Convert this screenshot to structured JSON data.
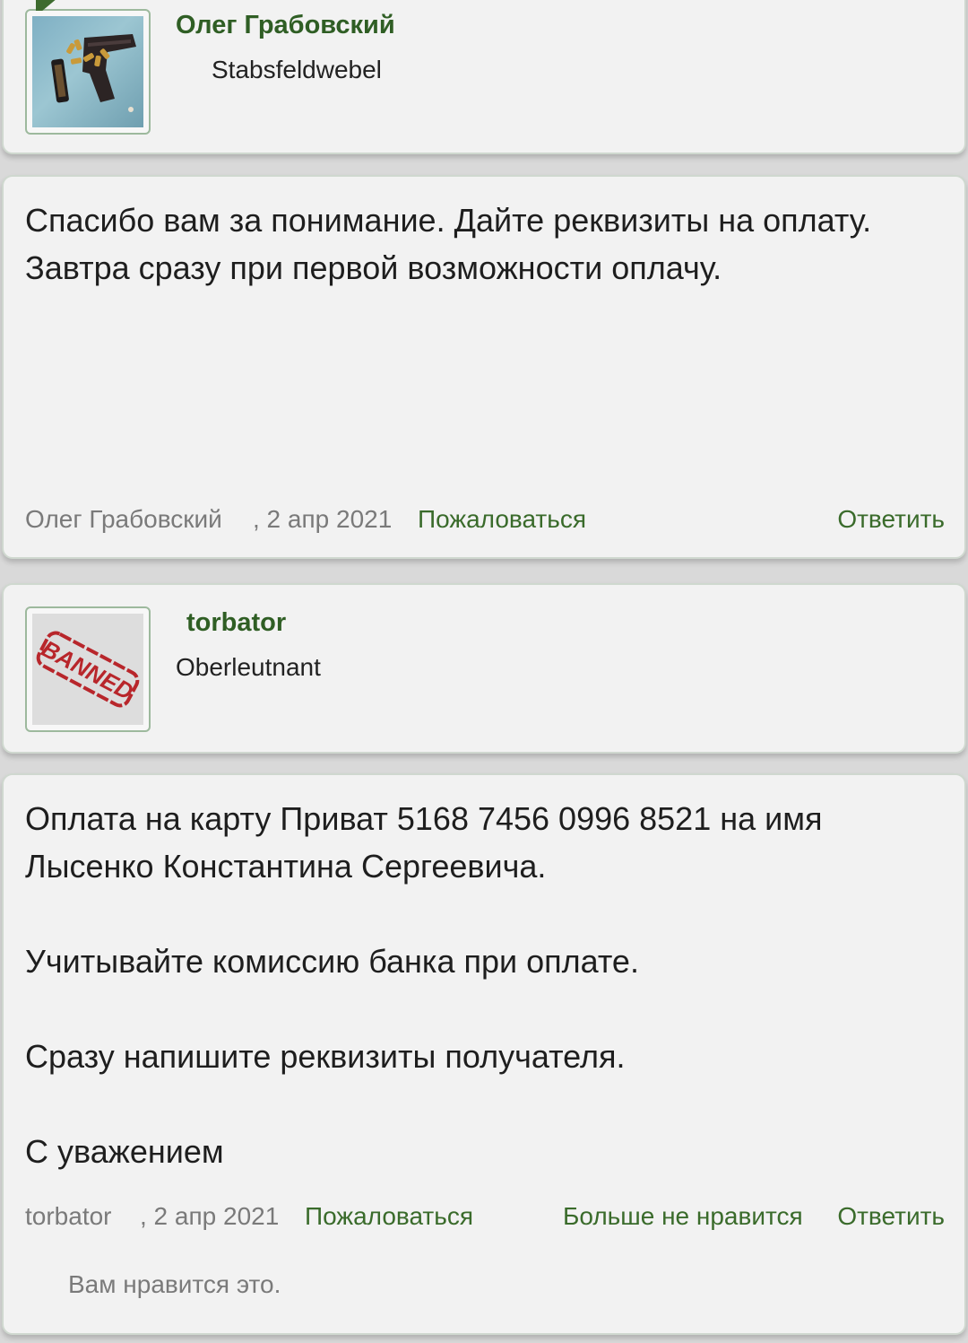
{
  "posts": [
    {
      "user": {
        "name": "Олег Грабовский",
        "rank": "Stabsfeldwebel",
        "avatar_icon": "pistol-avatar-icon"
      },
      "message": {
        "lines": [
          "Спасибо вам за понимание. Дайте реквизиты на оплату. Завтра сразу при первой возможности оплачу."
        ],
        "author": "Олег Грабовский",
        "date": ", 2 апр 2021",
        "report_label": "Пожаловаться",
        "reply_label": "Ответить"
      }
    },
    {
      "user": {
        "name": "torbator",
        "rank": "Oberleutnant",
        "avatar_icon": "banned-stamp-icon",
        "avatar_text": "BANNED"
      },
      "message": {
        "paragraphs": [
          "Оплата на карту Приват 5168 7456 0996 8521 на имя Лысенко Константина Сергеевича.",
          "Учитывайте комиссию банка при оплате.",
          "Сразу напишите реквизиты получателя.",
          "С уважением"
        ],
        "author": "torbator",
        "date": ", 2 апр 2021",
        "report_label": "Пожаловаться",
        "unlike_label": "Больше не нравится",
        "reply_label": "Ответить",
        "liked_note": "Вам нравится это."
      }
    }
  ],
  "colors": {
    "username": "#2f5e24",
    "link": "#3a6b2b",
    "meta": "#7a7a7a",
    "card_bg": "#f2f2f2",
    "page_bg": "#d9d9d9",
    "stamp_red": "#b8262b"
  }
}
